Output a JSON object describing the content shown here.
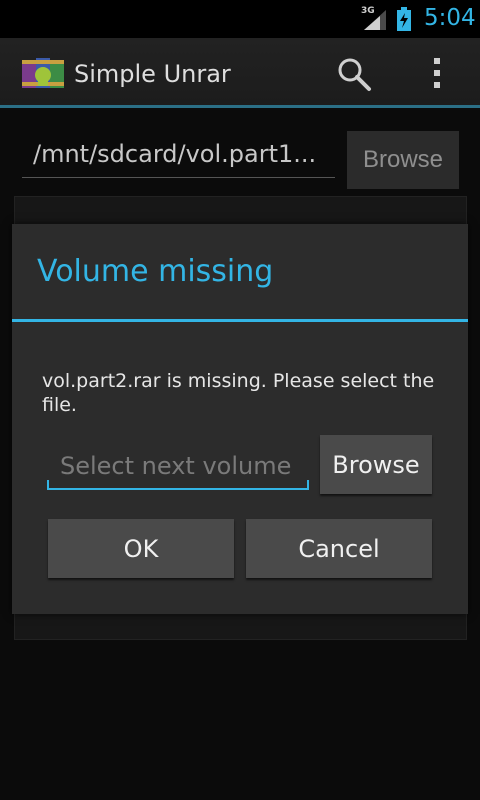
{
  "status_bar": {
    "network": "3G",
    "clock": "5:04"
  },
  "action_bar": {
    "title": "Simple Unrar"
  },
  "main": {
    "path_value": "/mnt/sdcard/vol.part1...",
    "browse_label": "Browse"
  },
  "dialog": {
    "title": "Volume missing",
    "message": "vol.part2.rar is missing. Please select the file.",
    "input_placeholder": "Select next volume",
    "browse_label": "Browse",
    "ok_label": "OK",
    "cancel_label": "Cancel"
  },
  "colors": {
    "accent": "#33b5e5",
    "dialog_bg": "#2c2c2c",
    "button_bg": "#4a4a4a"
  }
}
